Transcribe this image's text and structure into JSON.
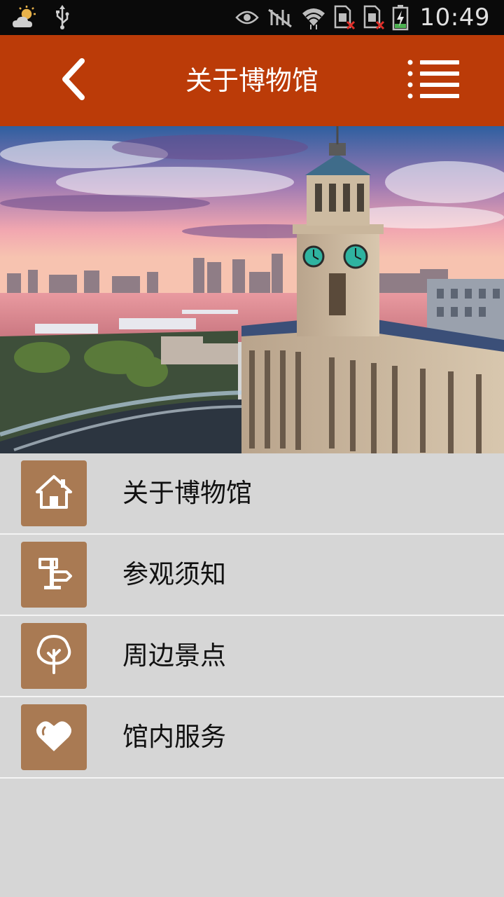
{
  "status_bar": {
    "time": "10:49",
    "icons": [
      "weather-partly-cloudy-icon",
      "usb-icon",
      "eye-icon",
      "mute-icon",
      "wifi-icon",
      "sim1-no-signal-icon",
      "sim2-no-signal-icon",
      "battery-charging-icon"
    ]
  },
  "header": {
    "title": "关于博物馆",
    "back_icon": "chevron-left-icon",
    "menu_icon": "list-menu-icon",
    "background": "#bb3b08"
  },
  "hero": {
    "image": "clock-tower-waterfront-photo"
  },
  "menu": {
    "items": [
      {
        "label": "关于博物馆",
        "icon": "house-icon"
      },
      {
        "label": "参观须知",
        "icon": "signpost-icon"
      },
      {
        "label": "周边景点",
        "icon": "tree-icon"
      },
      {
        "label": "馆内服务",
        "icon": "heart-icon"
      }
    ],
    "icon_bg": "#a97a53"
  }
}
